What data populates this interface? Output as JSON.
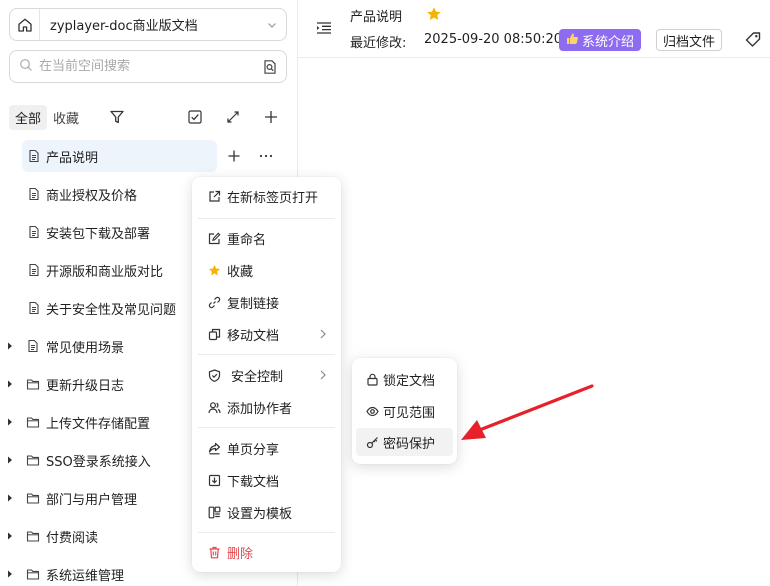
{
  "sidebar": {
    "space_name": "zyplayer-doc商业版文档",
    "search_placeholder": "在当前空间搜索",
    "tabs": [
      {
        "label": "全部",
        "active": true
      },
      {
        "label": "收藏",
        "active": false
      }
    ],
    "tree": [
      {
        "label": "产品说明",
        "type": "doc",
        "active": true
      },
      {
        "label": "商业授权及价格",
        "type": "doc"
      },
      {
        "label": "安装包下载及部署",
        "type": "doc"
      },
      {
        "label": "开源版和商业版对比",
        "type": "doc"
      },
      {
        "label": "关于安全性及常见问题",
        "type": "doc"
      },
      {
        "label": "常见使用场景",
        "type": "doc-collapsed"
      },
      {
        "label": "更新升级日志",
        "type": "folder"
      },
      {
        "label": "上传文件存储配置",
        "type": "folder"
      },
      {
        "label": "SSO登录系统接入",
        "type": "folder"
      },
      {
        "label": "部门与用户管理",
        "type": "folder"
      },
      {
        "label": "付费阅读",
        "type": "folder"
      },
      {
        "label": "系统运维管理",
        "type": "folder"
      }
    ]
  },
  "header": {
    "doc_title": "产品说明",
    "last_modified_label": "最近修改:",
    "last_modified_time": "2025-09-20 08:50:20",
    "intro_badge": "系统介绍",
    "archive_button": "归档文件"
  },
  "context_menu": {
    "items": [
      {
        "label": "在新标签页打开",
        "icon": "external-link-icon"
      },
      {
        "label": "重命名",
        "icon": "edit-icon"
      },
      {
        "label": "收藏",
        "icon": "star-icon"
      },
      {
        "label": "复制链接",
        "icon": "link-icon"
      },
      {
        "label": "移动文档",
        "icon": "move-icon",
        "submenu": true
      },
      {
        "label": "安全控制",
        "icon": "shield-icon",
        "submenu": true
      },
      {
        "label": "添加协作者",
        "icon": "users-icon"
      },
      {
        "label": "单页分享",
        "icon": "share-icon"
      },
      {
        "label": "下载文档",
        "icon": "download-icon"
      },
      {
        "label": "设置为模板",
        "icon": "template-icon"
      },
      {
        "label": "删除",
        "icon": "trash-icon",
        "danger": true
      }
    ]
  },
  "security_submenu": {
    "items": [
      {
        "label": "锁定文档",
        "icon": "lock-icon"
      },
      {
        "label": "可见范围",
        "icon": "eye-icon"
      },
      {
        "label": "密码保护",
        "icon": "key-icon",
        "hover": true
      }
    ]
  },
  "colors": {
    "accent": "#8e6cf0",
    "star": "#f5b400",
    "danger": "#e5484d",
    "annotation_arrow": "#e8202a",
    "active_item_bg": "#eef4fc"
  }
}
